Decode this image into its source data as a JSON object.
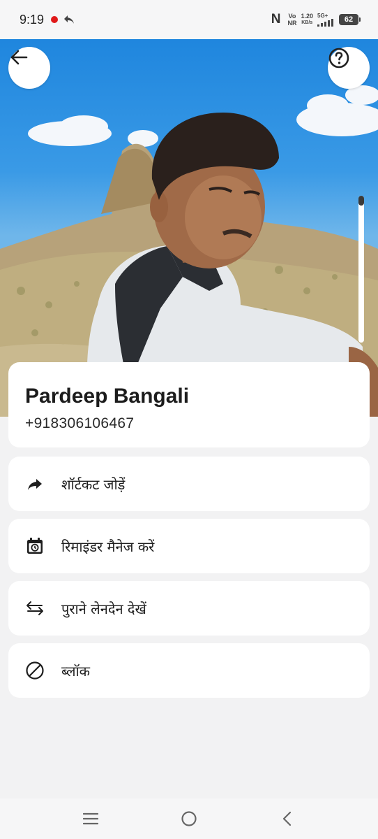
{
  "status_bar": {
    "time": "9:19",
    "net_top": "Vo",
    "net_bottom": "NR",
    "speed_value": "1.20",
    "speed_unit": "KB/s",
    "network_type": "5G+",
    "battery": "62",
    "recording_color": "#e0191a"
  },
  "header": {
    "back_icon": "arrow-left-icon",
    "help_icon": "question-circle-icon"
  },
  "profile": {
    "name": "Pardeep Bangali",
    "phone": "+918306106467"
  },
  "menu": [
    {
      "icon": "share-arrow-icon",
      "label": "शॉर्टकट जोड़ें"
    },
    {
      "icon": "calendar-clock-icon",
      "label": "रिमाइंडर मैनेज करें"
    },
    {
      "icon": "swap-arrows-icon",
      "label": "पुराने लेनदेन देखें"
    },
    {
      "icon": "block-icon",
      "label": "ब्लॉक"
    }
  ],
  "nav_bar": {
    "items": [
      "menu-icon",
      "home-circle-icon",
      "back-chevron-icon"
    ]
  }
}
